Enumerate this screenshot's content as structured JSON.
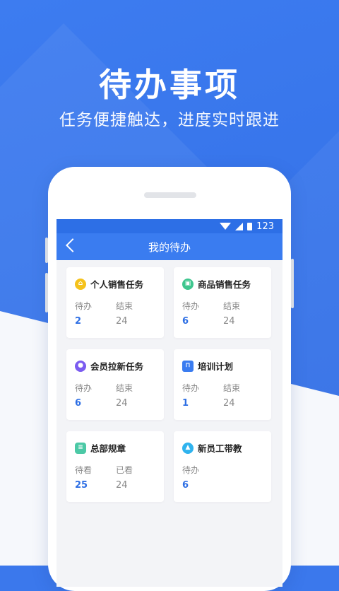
{
  "promo": {
    "headline": "待办事项",
    "subhead": "任务便捷触达，进度实时跟进"
  },
  "status_bar": {
    "time": "123"
  },
  "nav": {
    "title": "我的待办"
  },
  "cards": [
    {
      "title": "个人销售任务",
      "icon": "home-icon",
      "icon_color": "#f5c21b",
      "left_label": "待办",
      "left_value": "2",
      "right_label": "结束",
      "right_value": "24"
    },
    {
      "title": "商品销售任务",
      "icon": "bag-icon",
      "icon_color": "#3ec68e",
      "left_label": "待办",
      "left_value": "6",
      "right_label": "结束",
      "right_value": "24"
    },
    {
      "title": "会员拉新任务",
      "icon": "user-icon",
      "icon_color": "#7b5cf0",
      "left_label": "待办",
      "left_value": "6",
      "right_label": "结束",
      "right_value": "24"
    },
    {
      "title": "培训计划",
      "icon": "cart-icon",
      "icon_color": "#3a7cf0",
      "left_label": "待办",
      "left_value": "1",
      "right_label": "结束",
      "right_value": "24"
    },
    {
      "title": "总部规章",
      "icon": "document-icon",
      "icon_color": "#4cc9a6",
      "left_label": "待看",
      "left_value": "25",
      "right_label": "已看",
      "right_value": "24"
    },
    {
      "title": "新员工带教",
      "icon": "graduation-cap-icon",
      "icon_color": "#2fb3ee",
      "left_label": "待办",
      "left_value": "6"
    }
  ]
}
